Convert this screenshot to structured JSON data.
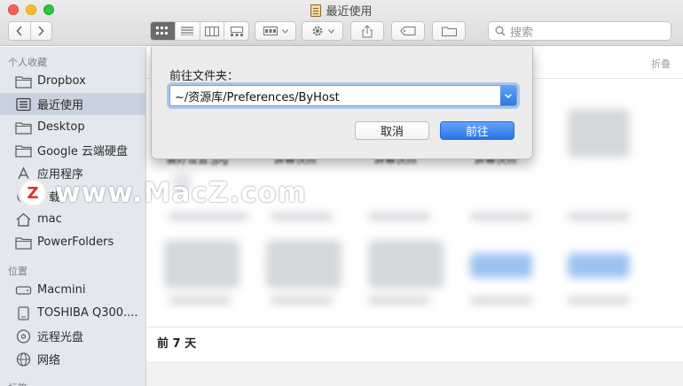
{
  "window": {
    "title": "最近使用",
    "icon": "recents-doc-icon"
  },
  "toolbar": {
    "nav_back": "‹",
    "nav_forward": "›",
    "view_modes": [
      "icon-view",
      "list-view",
      "column-view",
      "gallery-view"
    ],
    "group_icon": "group-by-icon",
    "action_icon": "gear-icon",
    "share_icon": "share-icon",
    "tag_icon": "tag-icon",
    "new_folder_icon": "new-folder-icon",
    "search_placeholder": "搜索"
  },
  "sidebar": {
    "favorites_header": "个人收藏",
    "favorites": [
      {
        "label": "Dropbox",
        "icon": "folder-icon"
      },
      {
        "label": "最近使用",
        "icon": "recents-icon",
        "selected": true
      },
      {
        "label": "Desktop",
        "icon": "folder-icon"
      },
      {
        "label": "Google 云端硬盘",
        "icon": "folder-icon"
      },
      {
        "label": "应用程序",
        "icon": "applications-icon"
      },
      {
        "label": "下载",
        "icon": "downloads-icon"
      },
      {
        "label": "mac",
        "icon": "home-icon"
      },
      {
        "label": "PowerFolders",
        "icon": "folder-icon"
      }
    ],
    "locations_header": "位置",
    "locations": [
      {
        "label": "Macmini",
        "icon": "hard-drive-icon"
      },
      {
        "label": "TOSHIBA Q300....",
        "icon": "external-drive-icon"
      },
      {
        "label": "远程光盘",
        "icon": "optical-disc-icon"
      },
      {
        "label": "网络",
        "icon": "network-icon"
      }
    ],
    "tags_header": "标签"
  },
  "content": {
    "collapse_label": "折叠",
    "files": [
      "偏好设置.jpg",
      "屏幕快照",
      "屏幕快照",
      "屏幕快照"
    ],
    "period_label": "前 7 天"
  },
  "dialog": {
    "title": "前往文件夹：",
    "path_value": "~/资源库/Preferences/ByHost",
    "cancel_label": "取消",
    "go_label": "前往"
  },
  "watermark": {
    "logo_letter": "Z",
    "text": "www.MacZ.com"
  },
  "colors": {
    "accent": "#2a74e8",
    "sidebar_bg": "#e3e8ee",
    "selection": "#c9d3e0"
  }
}
